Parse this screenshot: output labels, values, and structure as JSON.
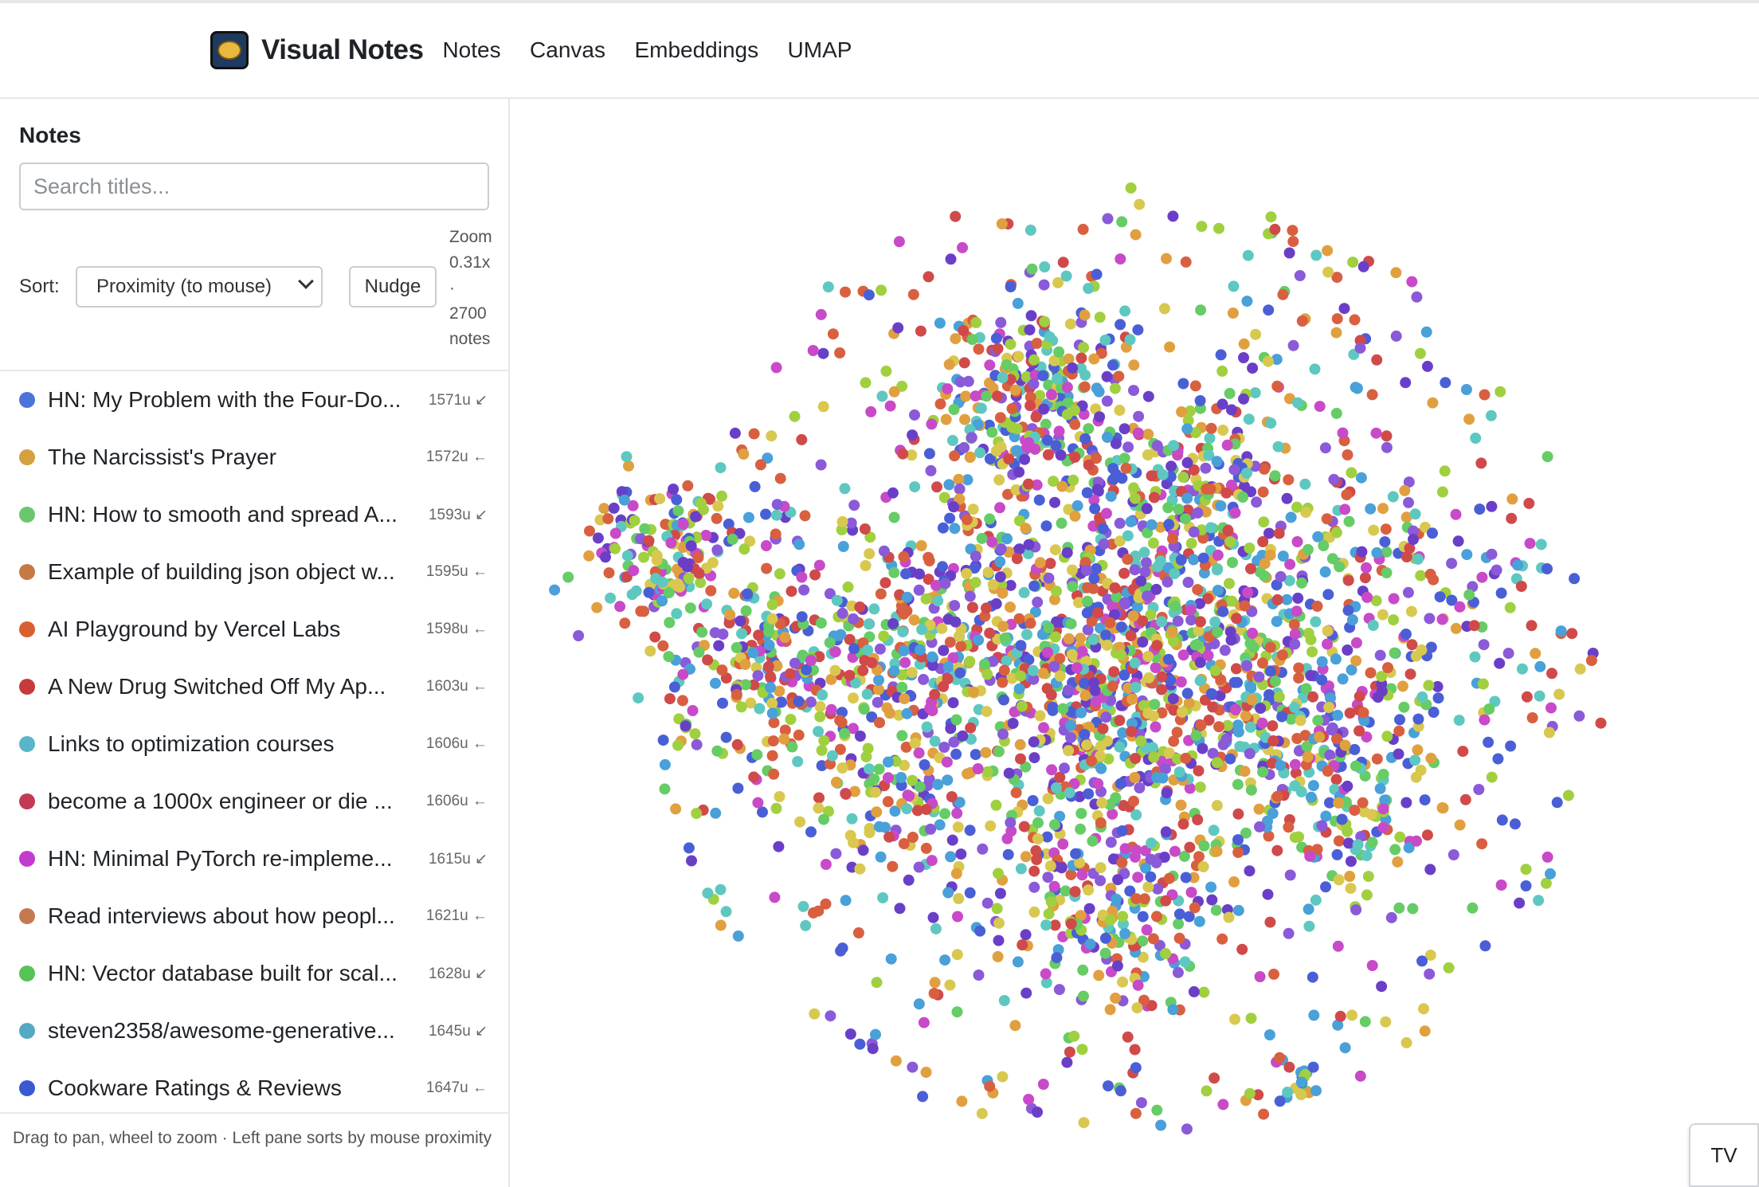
{
  "app": {
    "name": "Visual Notes",
    "nav": [
      "Notes",
      "Canvas",
      "Embeddings",
      "UMAP"
    ]
  },
  "sidebar": {
    "title": "Notes",
    "search_placeholder": "Search titles...",
    "sort_label": "Sort:",
    "sort_value": "Proximity (to mouse)",
    "nudge_label": "Nudge",
    "zoom_lines": [
      "Zoom",
      "0.31x",
      "·",
      "2700",
      "notes"
    ],
    "items": [
      {
        "title": "HN: My Problem with the Four-Do...",
        "meta": "1571u ↙",
        "color": "#4a74d9"
      },
      {
        "title": "The Narcissist's Prayer",
        "meta": "1572u ←",
        "color": "#d4a040"
      },
      {
        "title": "HN: How to smooth and spread A...",
        "meta": "1593u ↙",
        "color": "#6cc66c"
      },
      {
        "title": "Example of building json object w...",
        "meta": "1595u ←",
        "color": "#c47a45"
      },
      {
        "title": "AI Playground by Vercel Labs",
        "meta": "1598u ←",
        "color": "#d8602f"
      },
      {
        "title": "A New Drug Switched Off My Ap...",
        "meta": "1603u ←",
        "color": "#c73a3a"
      },
      {
        "title": "Links to optimization courses",
        "meta": "1606u ←",
        "color": "#5bb5c8"
      },
      {
        "title": "become a 1000x engineer or die ...",
        "meta": "1606u ←",
        "color": "#c33a55"
      },
      {
        "title": "HN: Minimal PyTorch re-impleme...",
        "meta": "1615u ↙",
        "color": "#c43ad0"
      },
      {
        "title": "Read interviews about how peopl...",
        "meta": "1621u ←",
        "color": "#c47a50"
      },
      {
        "title": "HN: Vector database built for scal...",
        "meta": "1628u ↙",
        "color": "#55c455"
      },
      {
        "title": "steven2358/awesome-generative...",
        "meta": "1645u ↙",
        "color": "#55a9c4"
      },
      {
        "title": "Cookware Ratings & Reviews",
        "meta": "1647u ←",
        "color": "#3a5ad0"
      }
    ],
    "footer": "Drag to pan, wheel to zoom · Left pane sorts by mouse proximity"
  },
  "canvas": {
    "palette": [
      "#4a5fd6",
      "#6a3fc8",
      "#d04a4a",
      "#e0a040",
      "#66cc66",
      "#5ec8c0",
      "#c84ac8",
      "#d8c850",
      "#4aa0d8",
      "#a0d040",
      "#d86040",
      "#8a5ad8"
    ],
    "tv_label": "TV"
  }
}
